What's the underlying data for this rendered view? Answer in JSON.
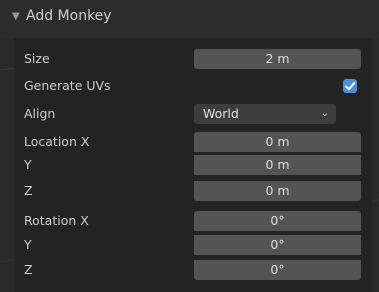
{
  "panel": {
    "title": "Add Monkey",
    "collapse_icon": "triangle-down-icon"
  },
  "fields": {
    "size": {
      "label": "Size",
      "value": "2 m"
    },
    "generate_uvs": {
      "label": "Generate UVs",
      "checked": true
    },
    "align": {
      "label": "Align",
      "value": "World"
    },
    "location": {
      "x": {
        "label": "Location X",
        "value": "0 m"
      },
      "y": {
        "label": "Y",
        "value": "0 m"
      },
      "z": {
        "label": "Z",
        "value": "0 m"
      }
    },
    "rotation": {
      "x": {
        "label": "Rotation X",
        "value": "0°"
      },
      "y": {
        "label": "Y",
        "value": "0°"
      },
      "z": {
        "label": "Z",
        "value": "0°"
      }
    }
  },
  "colors": {
    "checkbox_accent": "#4a91d8",
    "field_bg": "#545454",
    "select_bg": "#3d3d3d",
    "panel_bg": "#232323"
  }
}
